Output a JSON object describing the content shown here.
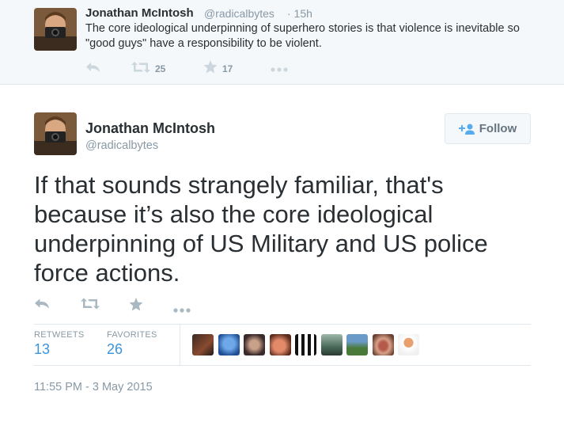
{
  "parent_tweet": {
    "name": "Jonathan McIntosh",
    "handle": "@radicalbytes",
    "time": "· 15h",
    "text": "The core ideological underpinning of superhero stories is that violence is inevitable so \"good guys\" have a responsibility to be violent.",
    "actions": {
      "reply_icon": "reply-icon",
      "retweet_icon": "retweet-icon",
      "retweet_count": "25",
      "favorite_icon": "star-icon",
      "favorite_count": "17",
      "more_icon": "more-icon"
    }
  },
  "main_tweet": {
    "name": "Jonathan McIntosh",
    "handle": "@radicalbytes",
    "follow_label": "Follow",
    "text": "If that sounds strangely familiar, that's because it’s also the core ideological underpinning of US Military and US police force actions.",
    "stats": {
      "retweets_label": "RETWEETS",
      "retweets_value": "13",
      "favorites_label": "FAVORITES",
      "favorites_value": "26"
    },
    "timestamp": "11:55 PM - 3 May 2015"
  },
  "colors": {
    "accent": "#3b94d9",
    "muted": "#8899a6",
    "icon": "#aab8c2",
    "text": "#292f33"
  }
}
